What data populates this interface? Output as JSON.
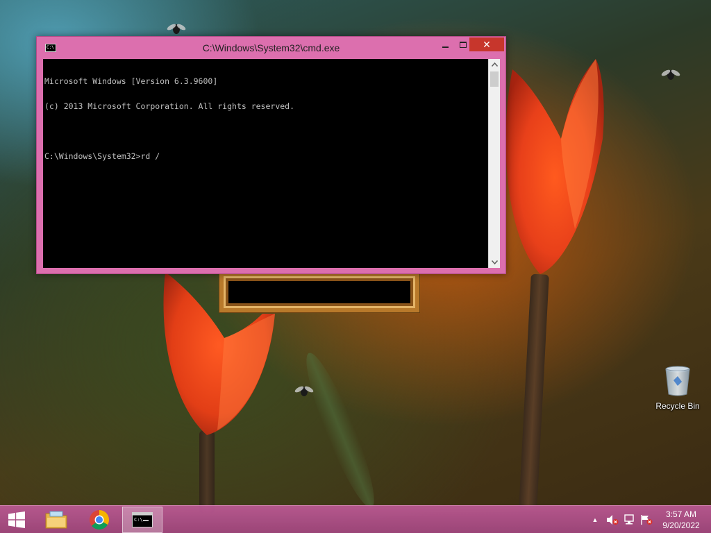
{
  "window": {
    "title": "C:\\Windows\\System32\\cmd.exe",
    "icon_text": "C:\\",
    "close_glyph": "✕"
  },
  "console": {
    "lines": [
      "Microsoft Windows [Version 6.3.9600]",
      "(c) 2013 Microsoft Corporation. All rights reserved.",
      "",
      "C:\\Windows\\System32>rd /"
    ]
  },
  "desktop": {
    "recycle_bin_label": "Recycle Bin"
  },
  "taskbar": {
    "start_icon": "windows-logo-icon",
    "pinned": [
      "file-explorer-icon",
      "chrome-icon",
      "cmd-icon"
    ],
    "tray_up_glyph": "▲",
    "clock_time": "3:57 AM",
    "clock_date": "9/20/2022"
  },
  "colors": {
    "window_frame": "#dc6fae",
    "close_button": "#c7362c",
    "console_bg": "#000000",
    "console_text": "#c0c0c0",
    "taskbar": "#b45a93"
  }
}
